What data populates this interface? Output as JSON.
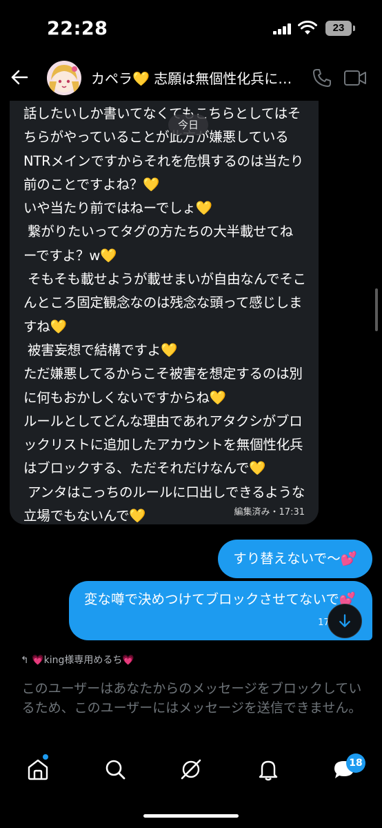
{
  "status_bar": {
    "time": "22:28",
    "battery": "23"
  },
  "header": {
    "title": "カペラ💛 志願は無個性化兵に…",
    "back_icon": "arrow-left-icon",
    "phone_icon": "phone-icon",
    "video_icon": "video-camera-icon"
  },
  "messages": {
    "date_label": "今日",
    "received": {
      "text": "話したいしか書いてなくてもこちらとしてはそちらがやっていることが此方が嫌悪しているNTRメインですからそれを危惧するのは当たり前のことですよね？💛\nいや当たり前ではねーでしょ💛\n 繋がりたいってタグの方たちの大半載せてねーですよ？w💛\n そもそも載せようが載せまいが自由なんでそこんところ固定観念なのは残念な頭って感じしますね💛\n 被害妄想で結構ですよ💛\nただ嫌悪してるからこそ被害を想定するのは別に何もおかしくないですからね💛\nルールとしてどんな理由であれアタクシがブロックリストに追加したアカウントを無個性化兵はブロックする、ただそれだけなんで💛\n アンタはこっちのルールに口出しできるような立場でもないんで💛",
      "meta": "編集済み・17:31"
    },
    "sent": [
      {
        "text": "すり替えないで〜💕"
      },
      {
        "text": "変な噂で決めつけてブロックさせてないで💕",
        "meta": "17:"
      }
    ]
  },
  "reply": {
    "text": "💗king様専用めるち💗"
  },
  "blocked_notice": "このユーザーはあなたからのメッセージをブロックしているため、このユーザーにはメッセージを送信できません。",
  "tabbar": {
    "tabs": [
      "home-icon",
      "search-icon",
      "grok-icon",
      "bell-icon",
      "messages-icon"
    ],
    "messages_badge": "18"
  },
  "colors": {
    "accent": "#1d9bf0",
    "received_bubble": "#1c1f23",
    "background": "#000000",
    "heart": "#ffcc1a"
  }
}
